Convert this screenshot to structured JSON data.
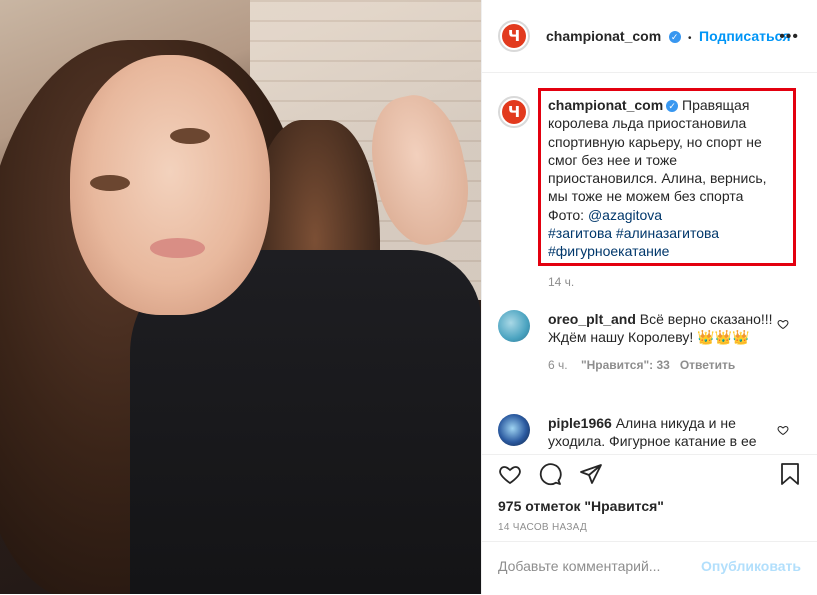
{
  "post": {
    "author": "championat_com",
    "avatar_glyph": "Ч",
    "follow_label": "Подписаться",
    "separator": "•",
    "more_icon": "more-horizontal-icon"
  },
  "caption": {
    "author": "championat_com",
    "text": "Правящая королева льда приостановила спортивную карьеру, но спорт не смог без нее и тоже приостановился. Алина, вернись, мы тоже не можем без спорта",
    "photo_prefix": "Фото: ",
    "photo_mention": "@azagitova",
    "hashtags": [
      "#загитова",
      "#алиназагитова",
      "#фигурноекатание"
    ],
    "time": "14 ч."
  },
  "comments": [
    {
      "user": "oreo_plt_and",
      "text": "Всё верно сказано!!! Ждём нашу Королеву! 👑👑👑",
      "time": "6 ч.",
      "likes": "\"Нравится\": 33",
      "reply": "Ответить"
    },
    {
      "user": "piple1966",
      "text": "Алина никуда и не уходила. Фигурное катание в ее"
    }
  ],
  "actions": {
    "like_icon": "heart-icon",
    "comment_icon": "comment-icon",
    "share_icon": "paper-plane-icon",
    "save_icon": "bookmark-icon"
  },
  "likes_text": "975 отметок \"Нравится\"",
  "posted_ago": "14 ЧАСОВ НАЗАД",
  "comment_box": {
    "placeholder": "Добавьте комментарий...",
    "publish_label": "Опубликовать"
  },
  "colors": {
    "accent": "#0095f6",
    "brand": "#e23a1e",
    "highlight_box": "#e3000f"
  }
}
